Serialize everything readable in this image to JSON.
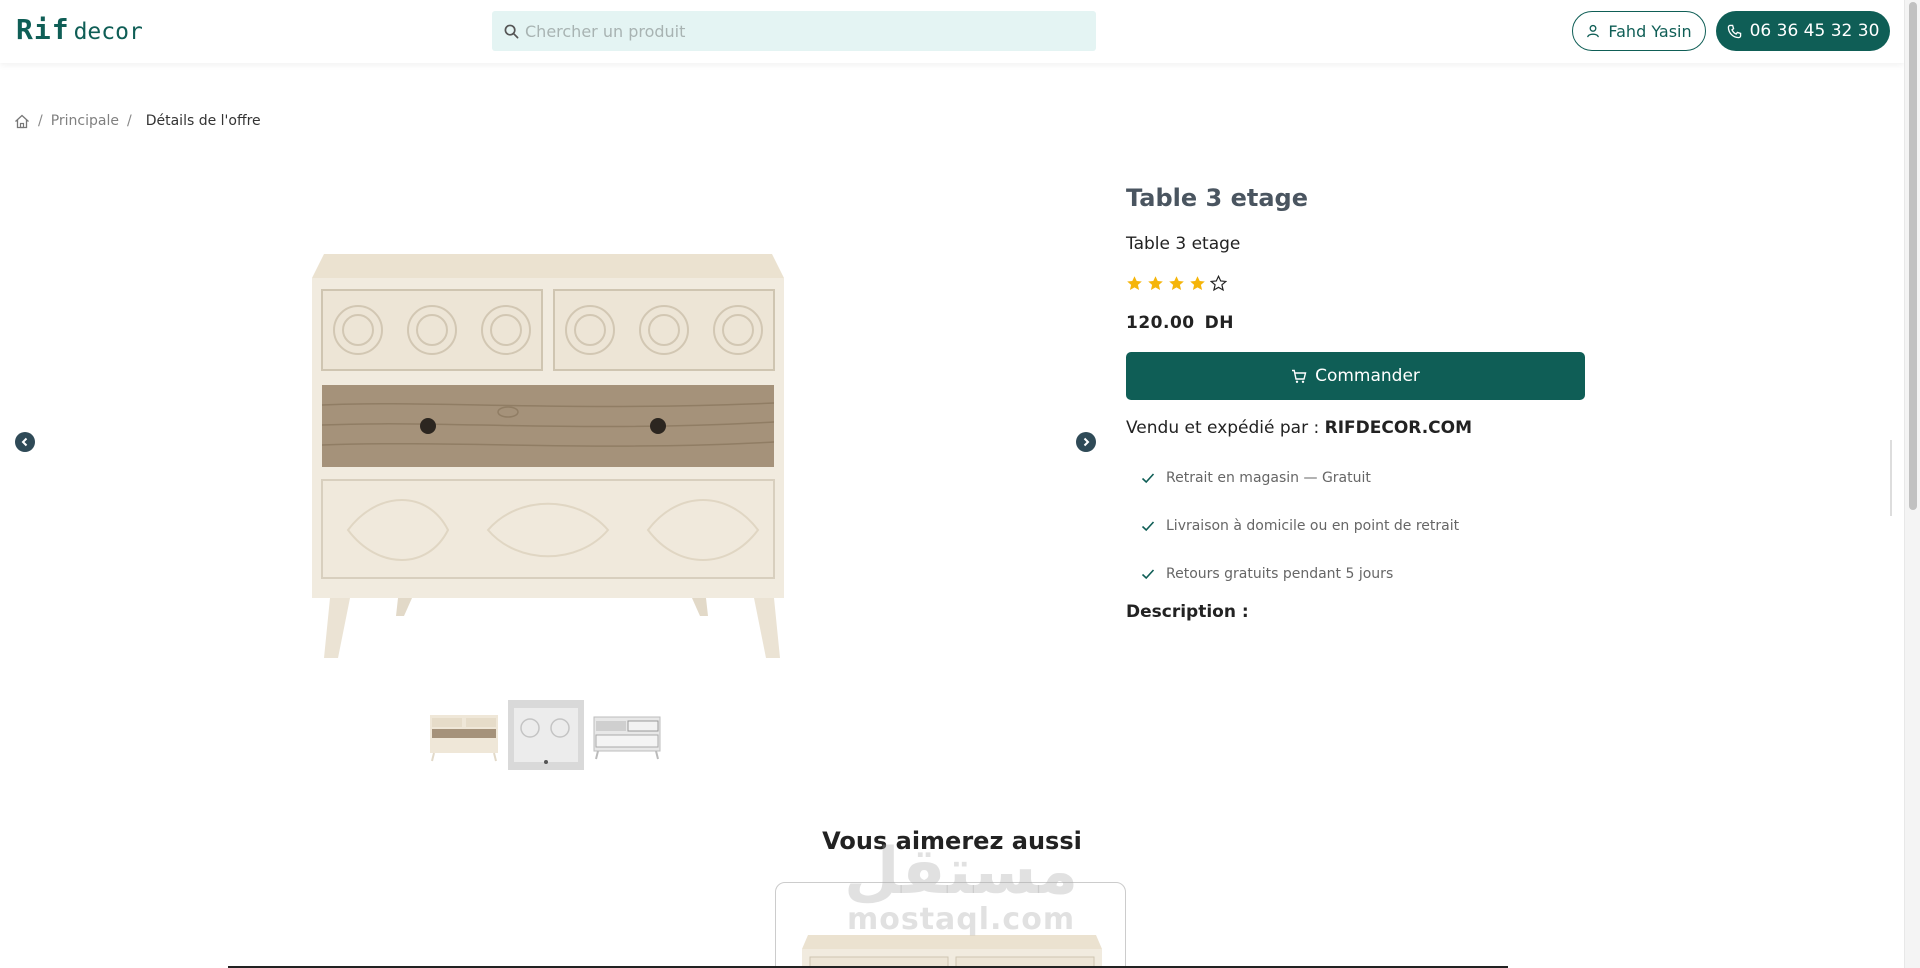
{
  "brand": {
    "logo_part1": "Rif",
    "logo_part2": "decor"
  },
  "search": {
    "placeholder": "Chercher un produit"
  },
  "header": {
    "user_name": "Fahd Yasin",
    "phone": "06 36 45 32 30"
  },
  "breadcrumb": {
    "home_icon": "home-icon",
    "separator": "/",
    "principal": "Principale",
    "current": "Détails de l'offre"
  },
  "product": {
    "title": "Table 3 etage",
    "subtitle": "Table 3 etage",
    "rating": 4,
    "rating_max": 5,
    "price": "120.00",
    "currency": "DH",
    "order_label": "Commander",
    "seller_prefix": "Vendu et expédié par :",
    "seller_name": "RIFDECOR.COM",
    "features": [
      "Retrait en magasin — Gratuit",
      "Livraison à domicile ou en point de retrait",
      "Retours gratuits pendant 5 jours"
    ],
    "description_label": "Description :"
  },
  "gallery": {
    "thumbnails": 3
  },
  "related": {
    "title": "Vous aimerez aussi"
  },
  "watermark": {
    "arabic": "مستقل",
    "latin": "mostaql.com"
  },
  "colors": {
    "primary": "#0f5e56",
    "search_bg": "#e4f4f3",
    "star": "#f5b50a",
    "arrow": "#2f4a57"
  }
}
